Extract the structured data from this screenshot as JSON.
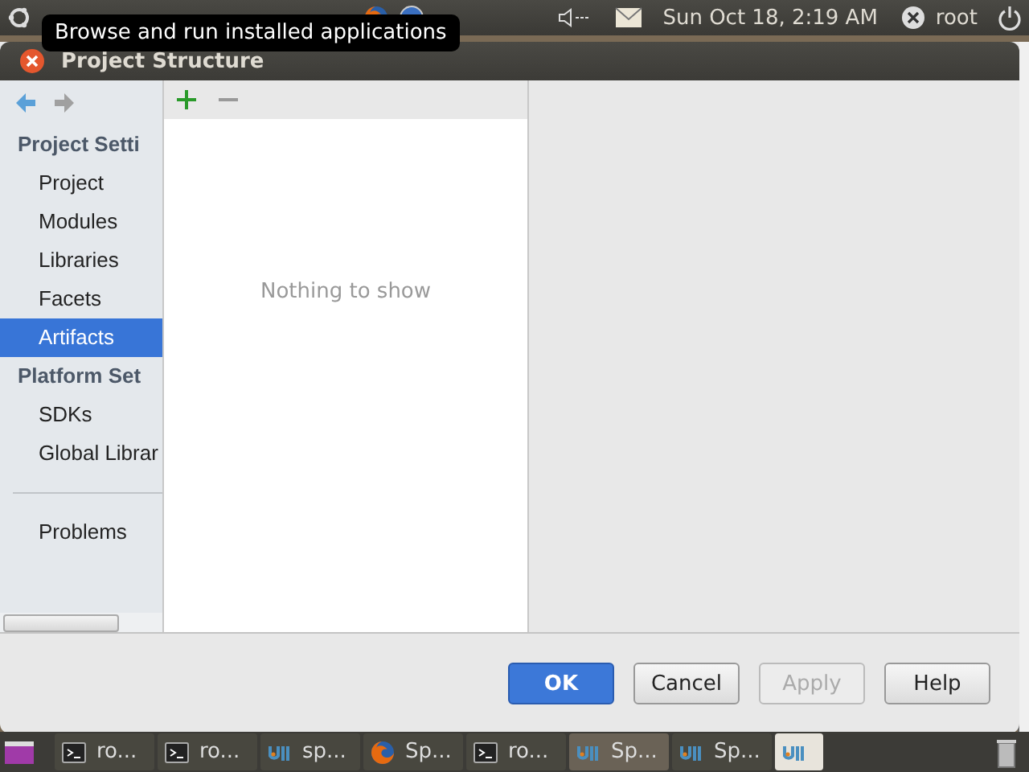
{
  "top_panel": {
    "clock": "Sun Oct 18,  2:19 AM",
    "user": "root"
  },
  "tooltip": "Browse and run installed applications",
  "window": {
    "title": "Project Structure"
  },
  "sidebar": {
    "sections": [
      {
        "heading": "Project Setti",
        "items": [
          {
            "label": "Project",
            "selected": false
          },
          {
            "label": "Modules",
            "selected": false
          },
          {
            "label": "Libraries",
            "selected": false
          },
          {
            "label": "Facets",
            "selected": false
          },
          {
            "label": "Artifacts",
            "selected": true
          }
        ]
      },
      {
        "heading": "Platform Set",
        "items": [
          {
            "label": "SDKs",
            "selected": false
          },
          {
            "label": "Global Librar",
            "selected": false
          }
        ]
      }
    ],
    "extra_items": [
      {
        "label": "Problems",
        "selected": false
      }
    ]
  },
  "list": {
    "empty_text": "Nothing to show"
  },
  "buttons": [
    {
      "label": "OK",
      "kind": "default",
      "disabled": false
    },
    {
      "label": "Cancel",
      "kind": "normal",
      "disabled": false
    },
    {
      "label": "Apply",
      "kind": "normal",
      "disabled": true
    },
    {
      "label": "Help",
      "kind": "normal",
      "disabled": false
    }
  ],
  "taskbar": [
    {
      "kind": "terminal",
      "label": "ro...",
      "selected": false
    },
    {
      "kind": "terminal",
      "label": "ro...",
      "selected": false
    },
    {
      "kind": "idea",
      "label": "sp...",
      "selected": false
    },
    {
      "kind": "firefox",
      "label": "Sp...",
      "selected": false
    },
    {
      "kind": "terminal",
      "label": "ro...",
      "selected": false
    },
    {
      "kind": "idea",
      "label": "Sp...",
      "selected": true
    },
    {
      "kind": "idea",
      "label": "Sp...",
      "selected": false
    }
  ]
}
